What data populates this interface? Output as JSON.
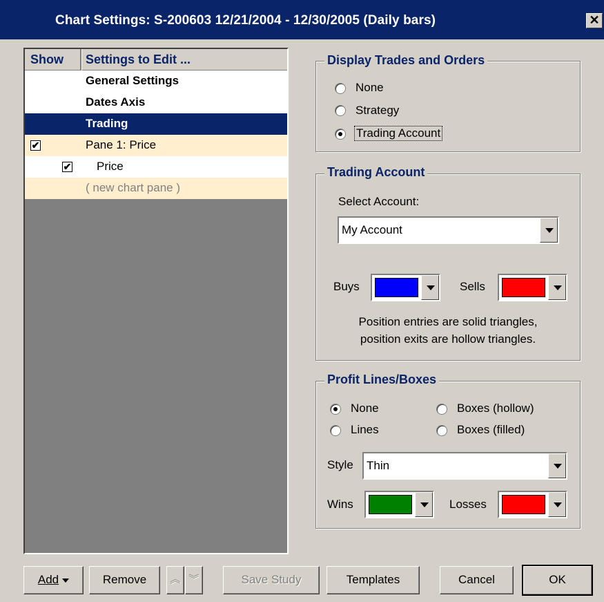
{
  "window": {
    "title": "Chart Settings: S-200603  12/21/2004 - 12/30/2005  (Daily bars)",
    "close_label": "✕"
  },
  "list": {
    "header_show": "Show",
    "header_settings": "Settings to Edit ...",
    "rows": [
      {
        "label": "General Settings"
      },
      {
        "label": "Dates Axis"
      },
      {
        "label": "Trading"
      },
      {
        "label": "Pane 1:  Price"
      },
      {
        "label": "Price"
      },
      {
        "label": "( new chart pane )"
      }
    ]
  },
  "display_trades": {
    "title": "Display Trades and Orders",
    "options": [
      "None",
      "Strategy",
      "Trading Account"
    ],
    "selected": "Trading Account"
  },
  "trading_account": {
    "title": "Trading Account",
    "select_label": "Select Account:",
    "account": "My Account",
    "buys_label": "Buys",
    "buys_color": "#0000ff",
    "sells_label": "Sells",
    "sells_color": "#ff0000",
    "note_line1": "Position entries are solid triangles,",
    "note_line2": "position exits are hollow triangles."
  },
  "profit": {
    "title": "Profit Lines/Boxes",
    "opt_none": "None",
    "opt_lines": "Lines",
    "opt_boxes_hollow": "Boxes (hollow)",
    "opt_boxes_filled": "Boxes (filled)",
    "selected": "None",
    "style_label": "Style",
    "style_value": "Thin",
    "wins_label": "Wins",
    "wins_color": "#008000",
    "losses_label": "Losses",
    "losses_color": "#ff0000"
  },
  "buttons": {
    "add": "Add",
    "remove": "Remove",
    "save_study": "Save Study",
    "templates": "Templates",
    "cancel": "Cancel",
    "ok": "OK"
  },
  "colors": {
    "title_bar": "#0a246a",
    "selected_row": "#0a246a",
    "pane_row": "#ffefcf"
  }
}
